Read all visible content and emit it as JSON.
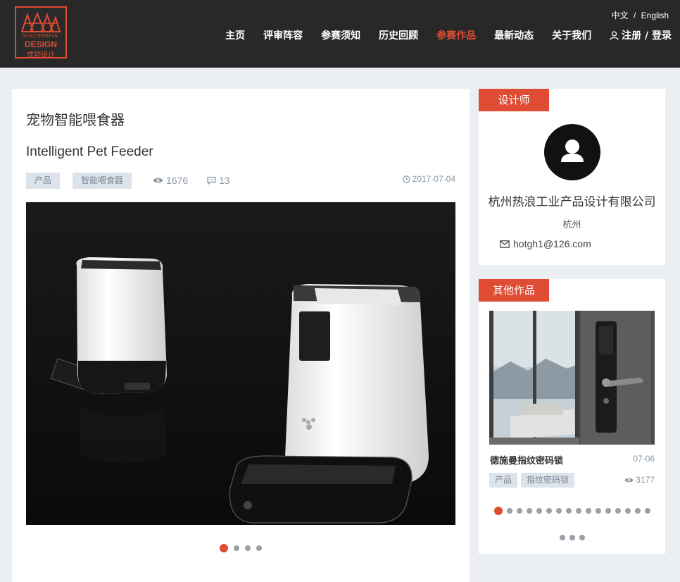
{
  "brand": {
    "line1": "SUCCESSFUL",
    "line2": "DESIGN",
    "line3": "成功设计",
    "accent": "#e04b33"
  },
  "lang": {
    "cn": "中文",
    "sep": "/",
    "en": "English"
  },
  "nav": {
    "items": [
      "主页",
      "评审阵容",
      "参赛须知",
      "历史回顾",
      "参赛作品",
      "最新动态",
      "关于我们"
    ],
    "active": "参赛作品",
    "login": "注册 / 登录"
  },
  "entry": {
    "title_cn": "宠物智能喂食器",
    "title_en": "Intelligent Pet Feeder",
    "tags": [
      "产品",
      "智能喂食器"
    ],
    "views": "1676",
    "comments": "13",
    "date": "2017-07-04",
    "carousel_total": 4,
    "carousel_active": 1
  },
  "designer": {
    "heading": "设计师",
    "company": "杭州热浪工业产品设计有限公司",
    "city": "杭州",
    "email": "hotgh1@126.com"
  },
  "other_works": {
    "heading": "其他作品",
    "item": {
      "title": "德施曼指纹密码锁",
      "date": "07-06",
      "tags": [
        "产品",
        "指纹密码锁"
      ],
      "views": "3177"
    },
    "dots_row1": 16,
    "dots_row2": 3,
    "dots_active": 1
  }
}
